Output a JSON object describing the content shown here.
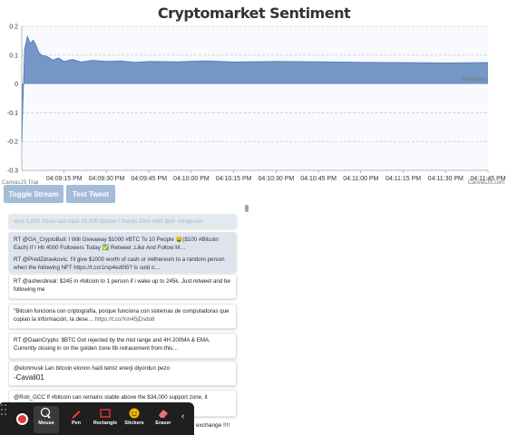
{
  "chart_data": {
    "type": "area",
    "title": "Cryptomarket Sentiment",
    "ylim": [
      -0.3,
      0.2
    ],
    "y_ticks": [
      "0.2",
      "0.1",
      "0",
      "-0.1",
      "-0.2",
      "-0.3"
    ],
    "y_tick_values": [
      0.2,
      0.1,
      0,
      -0.1,
      -0.2,
      -0.3
    ],
    "x_ticks": [
      "04:09:15 PM",
      "04:09:30 PM",
      "04:09:45 PM",
      "04:10:00 PM",
      "04:10:15 PM",
      "04:10:30 PM",
      "04:10:45 PM",
      "04:11:00 PM",
      "04:11:15 PM",
      "04:11:30 PM",
      "04:11:45 PM"
    ],
    "x_start": "04:09:00 PM",
    "x_end": "04:11:45 PM",
    "series": [
      {
        "values": [
          [
            "04:09:00 PM",
            -0.2
          ],
          [
            "04:09:01 PM",
            0.12
          ],
          [
            "04:09:02 PM",
            0.165
          ],
          [
            "04:09:03 PM",
            0.14
          ],
          [
            "04:09:04 PM",
            0.152
          ],
          [
            "04:09:05 PM",
            0.135
          ],
          [
            "04:09:06 PM",
            0.11
          ],
          [
            "04:09:07 PM",
            0.1
          ],
          [
            "04:09:09 PM",
            0.095
          ],
          [
            "04:09:11 PM",
            0.083
          ],
          [
            "04:09:13 PM",
            0.09
          ],
          [
            "04:09:15 PM",
            0.078
          ],
          [
            "04:09:18 PM",
            0.085
          ],
          [
            "04:09:21 PM",
            0.076
          ],
          [
            "04:09:25 PM",
            0.082
          ],
          [
            "04:09:30 PM",
            0.078
          ],
          [
            "04:09:35 PM",
            0.08
          ],
          [
            "04:09:40 PM",
            0.075
          ],
          [
            "04:09:45 PM",
            0.078
          ],
          [
            "04:09:55 PM",
            0.077
          ],
          [
            "04:10:05 PM",
            0.08
          ],
          [
            "04:10:15 PM",
            0.076
          ],
          [
            "04:10:30 PM",
            0.078
          ],
          [
            "04:10:45 PM",
            0.077
          ],
          [
            "04:11:00 PM",
            0.075
          ],
          [
            "04:11:15 PM",
            0.074
          ],
          [
            "04:11:30 PM",
            0.073
          ],
          [
            "04:11:45 PM",
            0.074
          ]
        ]
      }
    ],
    "fill_color": "#6d91c2",
    "line_color": "#4e7ab5",
    "plot_bg": "#f9faff",
    "grid": "dashed horizontal"
  },
  "watermarks": {
    "canvasjs_trial": "CanvasJS Trial",
    "canvasjs_link": "CanvasJS.com",
    "inner": "Sentiment"
  },
  "buttons": {
    "toggle_stream": "Toggle Stream",
    "test_tweet": "Test Tweet"
  },
  "feed": [
    {
      "text": "sent 3,000 #Dow last back 30,000 Bitcoin ! thanks Elon #eth $eth #dogecoin",
      "faded": true
    },
    {
      "text": "RT @GA_CryptoBull: I Will Giveaway $1000 #BTC To 10 People 🤑($100 #Bitcoin Each) If I Hit 4000 Followers Today ✅ Retweet ,Like And Follow M…",
      "faded": true
    },
    {
      "text": "RT @PredZdravkovic: I'll give $1000 worth of cash or #ethereum to a random person when the following NFT https://t.co/1rxp4ed0t5? is sold o…",
      "faded": true
    },
    {
      "text": "RT @ashwsbreal: $245 in #bitcoin to 1 person if i wake up to 245k. Just retweet and be following me",
      "faded": false
    },
    {
      "text": "\"Bitcoin funciona con criptografía, porque funciona con sistemas de computadoras que copian la información, la dese…",
      "link": "https://t.co/Xm45jDsdo8",
      "faded": false
    },
    {
      "text": "RT @DaanCrypto: $BTC Got rejected by the mid range and 4H 200MA & EMA. Currently closing in on the golden zone fib retracement from this…",
      "faded": false
    },
    {
      "text": "@elonmusk Lan bitcoin elonnn hadi temiz enerji diyordun pezo",
      "extra": "-Cavali01",
      "faded": false
    },
    {
      "text": "@Rob_GCC If #bitcoin can remains stable above the $34,000 support zone, it",
      "faded": false
    }
  ],
  "toolbar": {
    "mouse": "Mouse",
    "pen": "Pen",
    "rectangle": "Rectangle",
    "stickers": "Stickers",
    "eraser": "Eraser",
    "collapse": "‹",
    "overflow_text": "exchange !!!!"
  }
}
